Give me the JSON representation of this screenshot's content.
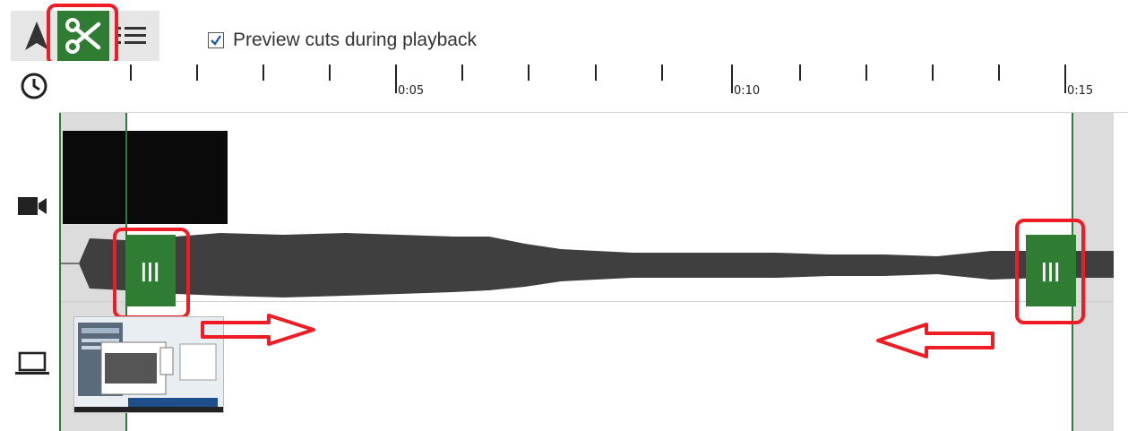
{
  "toolbar": {
    "tools": [
      {
        "name": "select",
        "icon": "arrow-select-icon"
      },
      {
        "name": "cut",
        "icon": "scissors-icon",
        "active": true
      },
      {
        "name": "list",
        "icon": "list-icon"
      }
    ],
    "preview_checkbox": {
      "label": "Preview cuts during playback",
      "checked": true
    }
  },
  "ruler": {
    "labels": [
      "0:05",
      "0:10",
      "0:15"
    ]
  },
  "tracks": [
    {
      "name": "video",
      "icon": "camera-icon"
    },
    {
      "name": "screen",
      "icon": "laptop-icon"
    }
  ],
  "handles": {
    "left_glyph": "|||",
    "right_glyph": "|||"
  },
  "colors": {
    "accent": "#2e7d32",
    "highlight": "#ee1c25",
    "waveform": "#3f3f3f",
    "excluded": "#dcdcdc"
  }
}
